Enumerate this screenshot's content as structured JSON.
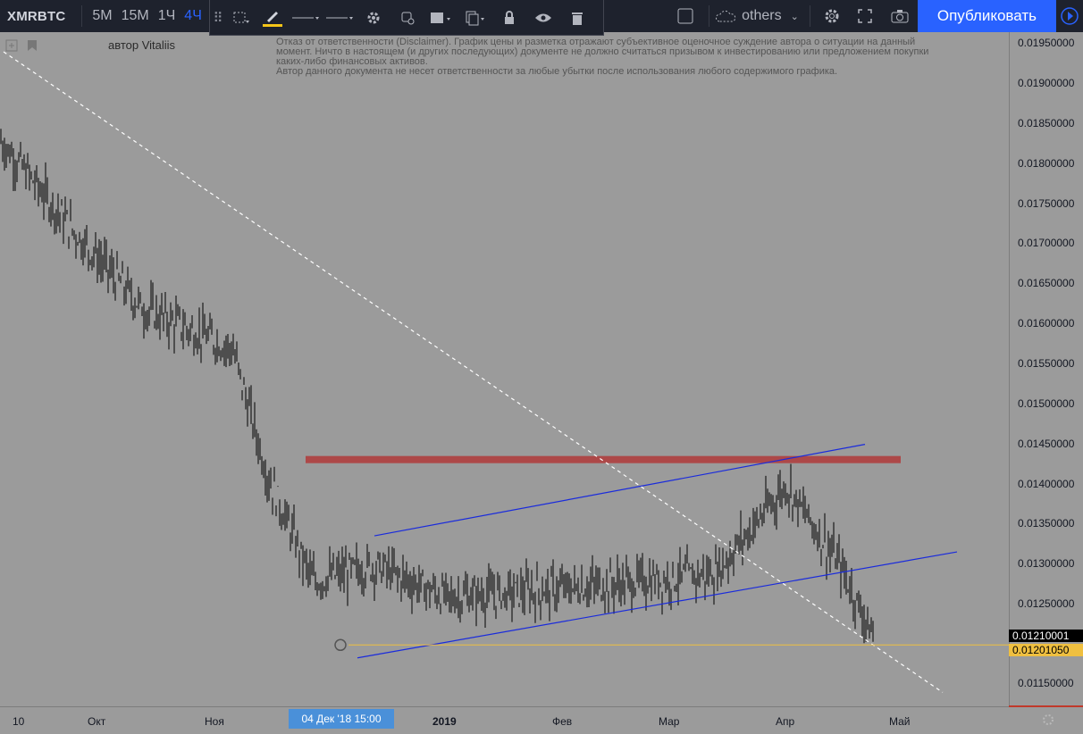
{
  "toolbar": {
    "symbol": "XMRBTC",
    "timeframes": [
      "5M",
      "15M",
      "1Ч",
      "4Ч"
    ],
    "active_tf": "4Ч",
    "others_label": "others",
    "publish_label": "Опубликовать"
  },
  "drawing_toolbar": {
    "icons": [
      "select-rect-icon",
      "pencil-icon",
      "line-style-icon",
      "line-width-icon",
      "settings-icon",
      "clone-icon",
      "layers-icon",
      "copy-icon",
      "lock-icon",
      "eye-icon",
      "trash-icon"
    ],
    "pen_color": "#f5c518"
  },
  "author": "автор Vitaliis",
  "disclaimer": [
    "Отказ от ответственности (Disclaimer). График цены и разметка отражают субъективное оценочное суждение автора о ситуации на данный",
    "момент. Ничто в настоящем (и других последующих) документе не должно считаться призывом к инвестированию или предложением покупки",
    "каких-либо финансовых активов.",
    "Автор данного документа не несет ответственности за любые убытки после использования любого содержимого графика."
  ],
  "price_labels": [
    "0.01950000",
    "0.01900000",
    "0.01850000",
    "0.01800000",
    "0.01750000",
    "0.01700000",
    "0.01650000",
    "0.01600000",
    "0.01550000",
    "0.01500000",
    "0.01450000",
    "0.01400000",
    "0.01350000",
    "0.01300000",
    "0.01250000",
    "0.01150000"
  ],
  "price_tags": [
    {
      "value": "0.01210001",
      "bg": "#000000",
      "fg": "#ffffff"
    },
    {
      "value": "0.01201050",
      "bg": "#f0c040",
      "fg": "#000000"
    }
  ],
  "time_labels": [
    "10",
    "Окт",
    "Ноя",
    "2019",
    "Фев",
    "Мар",
    "Апр",
    "Май"
  ],
  "crosshair_time": "04 Дек '18    15:00",
  "colors": {
    "resistance": "#b03a3a",
    "channel": "#1a2bdc",
    "support": "#f0c040",
    "trend": "#ffffff",
    "candle": "#000000"
  },
  "chart_data": {
    "type": "line",
    "title": "XMRBTC",
    "ylim": [
      0.0111,
      0.0197
    ],
    "x": [
      "Окт",
      "Ноя",
      "Дек",
      "2019",
      "Фев",
      "Мар",
      "Апр",
      "Май"
    ],
    "series": [
      {
        "values": [
          0.0183,
          0.0172,
          0.0162,
          0.0157,
          0.0141,
          0.0128,
          0.013,
          0.0126,
          0.0127,
          0.0128,
          0.0129,
          0.014,
          0.013,
          0.0121
        ]
      }
    ],
    "levels": {
      "resistance": 0.01432,
      "support": 0.0120105,
      "last": 0.01210001
    }
  }
}
